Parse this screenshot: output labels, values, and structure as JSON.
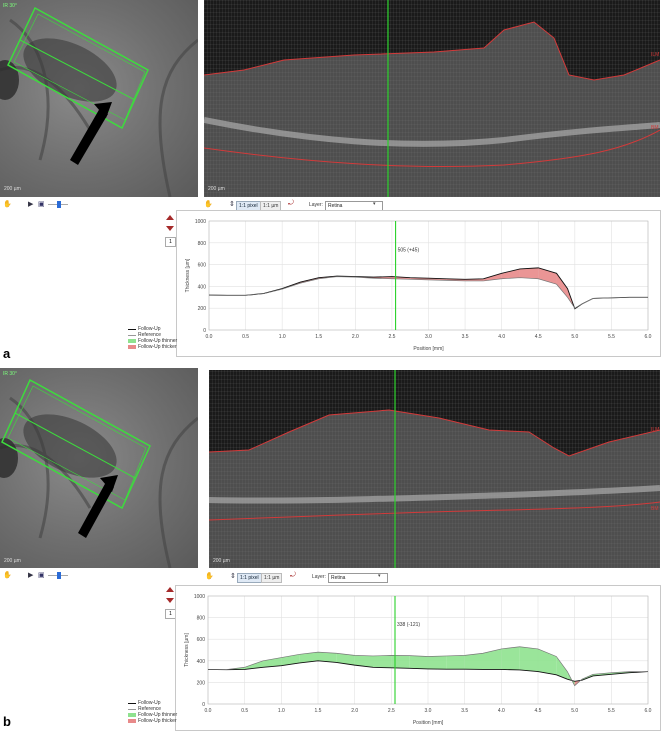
{
  "colors": {
    "followup_thinner": "#8fe28f",
    "followup_thicker": "#e88a8a",
    "cursor_line": "#2bd12b",
    "segmentation": "#d23a3a",
    "roi_box": "#3ddc3d"
  },
  "panels": [
    {
      "letter": "a",
      "fundus_scale": "200 µm",
      "fundus_tag": "IR 30°",
      "oct_scale": "200 µm",
      "oct_ilm": "ILM",
      "oct_bm": "BM",
      "toolbar": {
        "pixel_btn": "1:1 pixel",
        "um_btn": "1:1 µm",
        "layer_label": "Layer:",
        "layer_value": "Retina"
      },
      "page_num": "1",
      "cursor_label": "505 (+45)",
      "chart_data": {
        "type": "area",
        "x": [
          0.0,
          0.25,
          0.5,
          0.75,
          1.0,
          1.25,
          1.5,
          1.75,
          2.0,
          2.25,
          2.5,
          2.75,
          3.0,
          3.25,
          3.5,
          3.75,
          4.0,
          4.25,
          4.5,
          4.75,
          4.9,
          5.0,
          5.1,
          5.25,
          5.5,
          5.75,
          6.0
        ],
        "series": [
          {
            "name": "Follow-Up",
            "values": [
              320,
              318,
              318,
              335,
              380,
              440,
              480,
              495,
              490,
              485,
              490,
              480,
              475,
              470,
              465,
              470,
              520,
              560,
              570,
              520,
              380,
              195,
              240,
              290,
              295,
              300,
              300
            ]
          },
          {
            "name": "Reference",
            "values": [
              320,
              318,
              318,
              333,
              375,
              430,
              470,
              490,
              485,
              475,
              470,
              465,
              460,
              455,
              450,
              450,
              470,
              480,
              470,
              420,
              300,
              200,
              240,
              290,
              295,
              300,
              300
            ]
          }
        ],
        "xlabel": "Position [mm]",
        "ylabel": "Thickness [µm]",
        "xlim": [
          0,
          6.0
        ],
        "ylim": [
          0,
          1000
        ],
        "xticks": [
          "0.0",
          "0.5",
          "1.0",
          "1.5",
          "2.0",
          "2.5",
          "3.0",
          "3.5",
          "4.0",
          "4.5",
          "5.0",
          "5.5",
          "6.0"
        ],
        "yticks": [
          "0",
          "200",
          "400",
          "600",
          "800",
          "1000"
        ],
        "cursor_x": 2.55,
        "legend": [
          "Follow-Up",
          "Reference",
          "Follow-Up thinner",
          "Follow-Up thicker"
        ]
      }
    },
    {
      "letter": "b",
      "fundus_scale": "200 µm",
      "fundus_tag": "IR 30°",
      "oct_scale": "200 µm",
      "oct_ilm": "ILM",
      "oct_bm": "BM",
      "toolbar": {
        "pixel_btn": "1:1 pixel",
        "um_btn": "1:1 µm",
        "layer_label": "Layer:",
        "layer_value": "Retina"
      },
      "page_num": "1",
      "cursor_label": "338 (-121)",
      "chart_data": {
        "type": "area",
        "x": [
          0.0,
          0.25,
          0.5,
          0.75,
          1.0,
          1.25,
          1.5,
          1.75,
          2.0,
          2.25,
          2.5,
          2.75,
          3.0,
          3.25,
          3.5,
          3.75,
          4.0,
          4.25,
          4.5,
          4.75,
          4.9,
          5.0,
          5.1,
          5.25,
          5.5,
          5.75,
          6.0
        ],
        "series": [
          {
            "name": "Follow-Up",
            "values": [
              320,
              318,
              320,
              340,
              355,
              380,
              400,
              385,
              360,
              340,
              335,
              330,
              325,
              322,
              322,
              320,
              320,
              315,
              300,
              270,
              230,
              210,
              220,
              260,
              275,
              290,
              300
            ]
          },
          {
            "name": "Reference",
            "values": [
              320,
              318,
              340,
              400,
              430,
              460,
              480,
              470,
              450,
              445,
              450,
              448,
              440,
              445,
              450,
              470,
              510,
              530,
              510,
              440,
              300,
              170,
              230,
              275,
              290,
              300,
              300
            ]
          }
        ],
        "xlabel": "Position [mm]",
        "ylabel": "Thickness [µm]",
        "xlim": [
          0,
          6.0
        ],
        "ylim": [
          0,
          1000
        ],
        "xticks": [
          "0.0",
          "0.5",
          "1.0",
          "1.5",
          "2.0",
          "2.5",
          "3.0",
          "3.5",
          "4.0",
          "4.5",
          "5.0",
          "5.5",
          "6.0"
        ],
        "yticks": [
          "0",
          "200",
          "400",
          "600",
          "800",
          "1000"
        ],
        "cursor_x": 2.55,
        "legend": [
          "Follow-Up",
          "Reference",
          "Follow-Up thinner",
          "Follow-Up thicker"
        ]
      }
    }
  ]
}
